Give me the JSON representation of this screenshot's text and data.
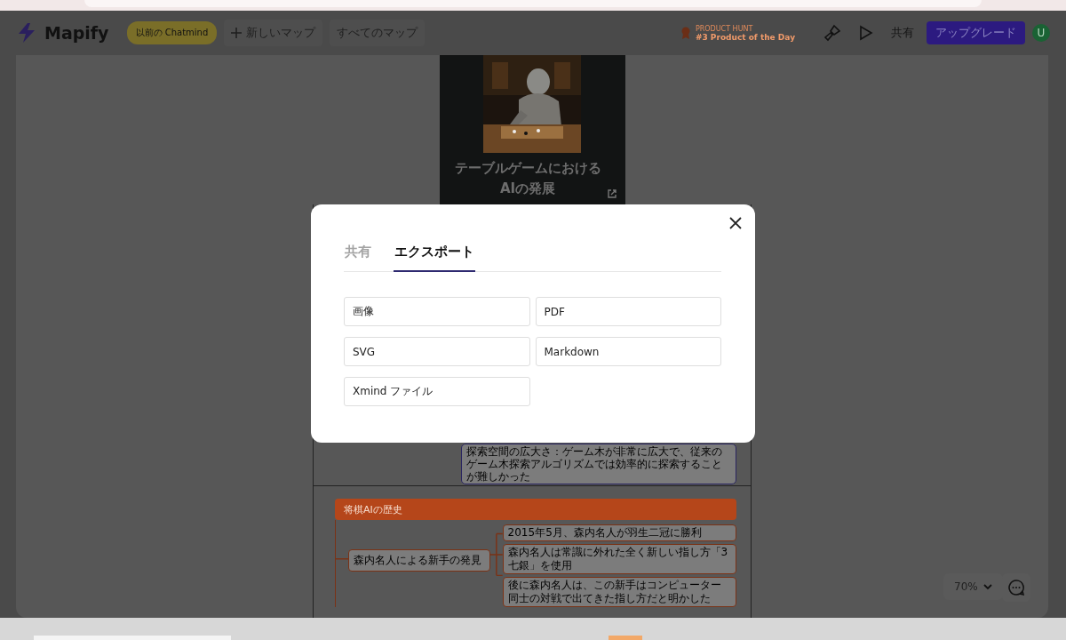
{
  "header": {
    "logo": "Mapify",
    "badge": "以前の Chatmind",
    "new_map": "新しいマップ",
    "all_maps": "すべてのマップ",
    "award": {
      "small": "PRODUCT HUNT",
      "main": "#3 Product of the Day"
    },
    "share": "共有",
    "upgrade": "アップグレード",
    "avatar": "U"
  },
  "map": {
    "cover": {
      "kind": "picture",
      "title": "テーブルゲームにおけるAIの発展"
    },
    "upper_node": "探索空間の広大さ：ゲーム木が非常に広大で、従来のゲーム木探索アルゴリズムでは効率的に探索することが難しかった",
    "section": {
      "title": "将棋AIの歴史",
      "branch": "森内名人による新手の発見",
      "leaves": [
        "2015年5月、森内名人が羽生二冠に勝利",
        "森内名人は常識に外れた全く新しい指し方「3七銀」を使用",
        "後に森内名人は、この新手はコンピューター同士の対戦で出てきた指し方だと明かした"
      ]
    }
  },
  "zoom": "70%",
  "dialog": {
    "tabs": [
      {
        "label": "共有",
        "selected": false
      },
      {
        "label": "エクスポート",
        "selected": true
      }
    ],
    "options": [
      "画像",
      "PDF",
      "SVG",
      "Markdown",
      "Xmind ファイル"
    ]
  }
}
